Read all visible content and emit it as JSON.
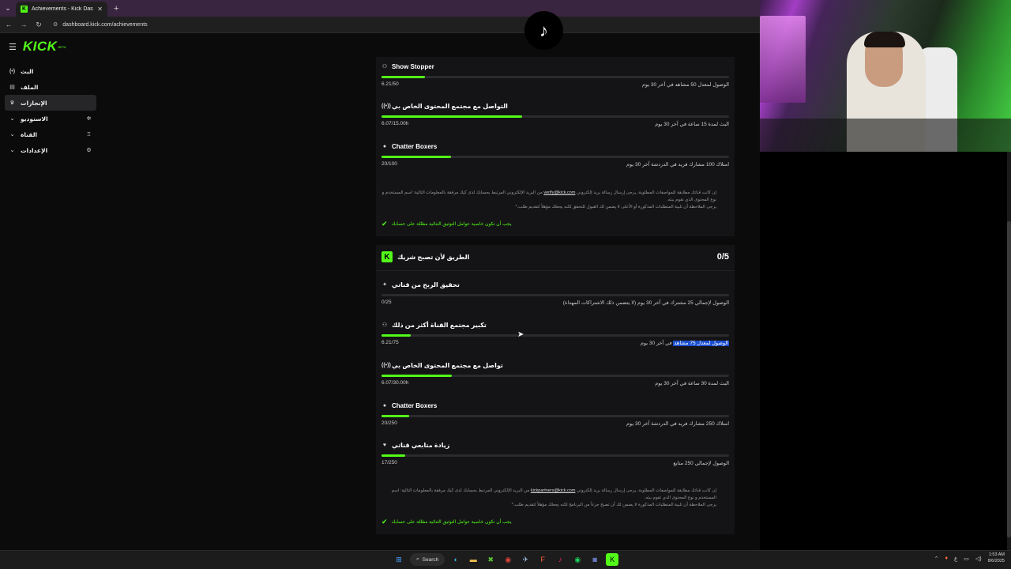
{
  "browser": {
    "tab_title": "Achievements - Kick Dashboard",
    "tab_close": "✕",
    "new_tab": "+",
    "url": "dashboard.kick.com/achievements"
  },
  "topnav": {
    "logo": "KICK",
    "logo_badge": "BETA"
  },
  "sidebar": {
    "items": [
      {
        "label": "البث",
        "icon": "broadcast-icon",
        "glyph": "(•)",
        "chevron": false
      },
      {
        "label": "الملف",
        "icon": "profile-icon",
        "glyph": "▤",
        "chevron": false
      },
      {
        "label": "الإنجازات",
        "icon": "trophy-icon",
        "glyph": "🏆",
        "chevron": false,
        "active": true
      },
      {
        "label": "الاستوديو",
        "icon": "studio-icon",
        "glyph": "✲",
        "chevron": true
      },
      {
        "label": "القناة",
        "icon": "channel-icon",
        "glyph": "♖",
        "chevron": true
      },
      {
        "label": "الإعدادات",
        "icon": "settings-icon",
        "glyph": "⚙",
        "chevron": true
      }
    ]
  },
  "card1": {
    "achievements": [
      {
        "title": "Show Stopper",
        "icon": "users-icon",
        "glyph": "⚇",
        "desc": "الوصول لمعدل 50 مشاهد في آخر 30 يوم",
        "value": "6.21/50",
        "progress": 0.124
      },
      {
        "title": "التواصل مع مجتمع المحتوى الخاص بي",
        "icon": "signal-icon",
        "glyph": "((•))",
        "desc": "البث لمدة 15 ساعة في آخر 30 يوم",
        "value": "6.07/15.00h",
        "progress": 0.405
      },
      {
        "title": "Chatter Boxers",
        "icon": "chat-icon",
        "glyph": "💬",
        "desc": "امتلاك 100 مشارك فريد في الدردشة آخر 30 يوم",
        "value": "20/100",
        "progress": 0.2
      }
    ],
    "note_line1_a": "إن كانت قناتك مطابقة للمواصفات المطلوبة، يرجى إرسال رسالة بريد إلكتروني",
    "note_line1_link": "verify@kick.com",
    "note_line1_b": "من البريد الإلكتروني المرتبط بحسابك لدى كيك مرفقة بالمعلومات التالية: اسم المستخدم و نوع المحتوى الذي تقوم ببثه.",
    "note_line2": "يرجى الملاحظة أن تلبية المتطلبات المذكورة أو الأعلى لا يضمن لك القبول للتحقق لكنه يجعلك مؤهلاً لتقديم طلب.*",
    "verify_text": "يجب أن تكون خاصية عوامل التوثيق الثنائية مفعّلة على حسابك",
    "verify_icon": "✔"
  },
  "card2": {
    "title": "الطريق لأن تصبح شريك",
    "score": "0/5",
    "achievements": [
      {
        "title": "تحقيق الربح من قناتي",
        "icon": "sparkle-icon",
        "glyph": "✦",
        "desc": "الوصول لإجمالي 25 مشترك في آخر 30 يوم (لا يتضمن ذلك الاشتراكات المهداة)",
        "value": "0/25",
        "progress": 0.0
      },
      {
        "title": "تكبير مجتمع القناة أكثر من ذلك",
        "icon": "users-icon",
        "glyph": "⚇",
        "desc_pre": "",
        "desc_hl": "الوصول لمعدل 75 مشاهد",
        "desc_post": " في آخر 30 يوم",
        "value": "6.21/75",
        "progress": 0.083
      },
      {
        "title": "تواصل مع مجتمع المحتوى الخاص بي",
        "icon": "signal-icon",
        "glyph": "((•))",
        "desc": "البث لمدة 30 ساعة في آخر 30 يوم",
        "value": "6.07/30.00h",
        "progress": 0.202
      },
      {
        "title": "Chatter Boxers",
        "icon": "chat-icon",
        "glyph": "💬",
        "desc": "امتلاك 250 مشارك فريد في الدردشة آخر 30 يوم",
        "value": "20/250",
        "progress": 0.08
      },
      {
        "title": "زيادة متابعي قناتي",
        "icon": "heart-icon",
        "glyph": "♥",
        "desc": "الوصول لإجمالي 250 متابع",
        "value": "17/250",
        "progress": 0.068
      }
    ],
    "note_line1_a": "إن كانت قناتك مطابقة للمواصفات المطلوبة، يرجى إرسال رسالة بريد إلكتروني",
    "note_line1_link": "kickpartners@kick.com",
    "note_line1_b": "من البريد الإلكتروني المرتبط بحسابك لدى كيك مرفقة بالمعلومات التالية: اسم المستخدم و نوع المحتوى الذي تقوم ببثه.",
    "note_line2": "يرجى الملاحظة أن تلبية المتطلبات المذكورة لا يضمن لك أن تصبح جزءاً من البرنامج لكنه يجعلك مؤهلاً لتقديم طلب.*",
    "verify_text": "يجب أن تكون خاصية عوامل التوثيق الثنائية مفعّلة على حسابك",
    "verify_icon": "✔"
  },
  "taskbar": {
    "search_label": "Search",
    "time": "1:53 AM",
    "date": "8/6/2025",
    "lang": "ع"
  },
  "colors": {
    "accent": "#53fc18",
    "card": "#141416",
    "page": "#0b0b0c"
  }
}
